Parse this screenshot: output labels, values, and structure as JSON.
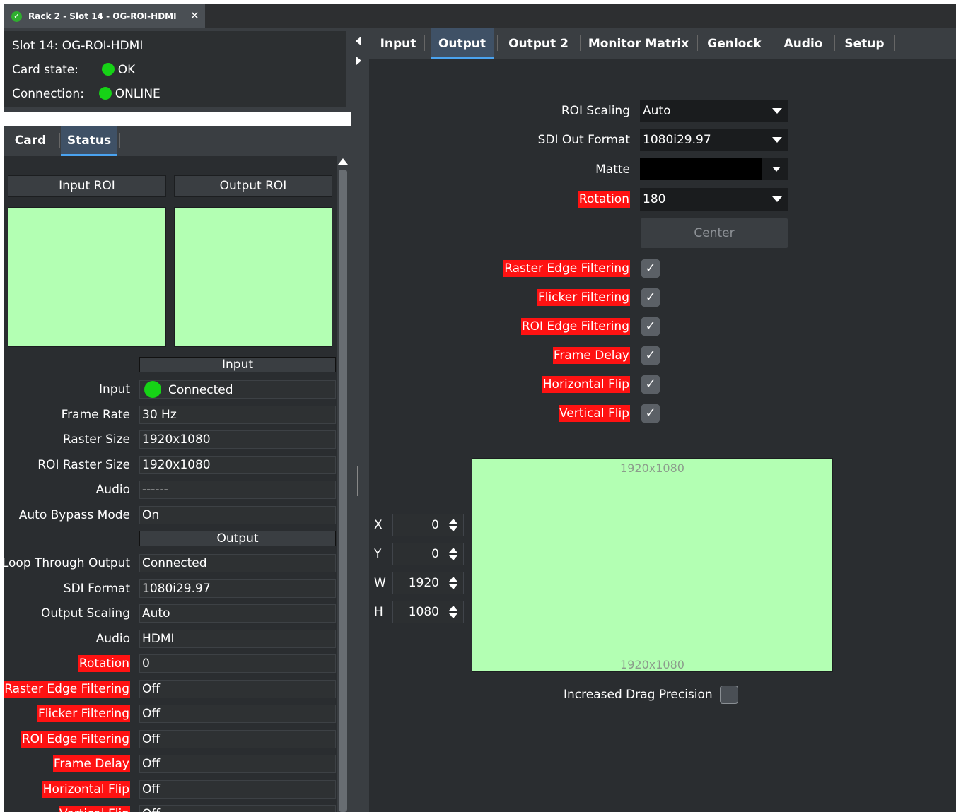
{
  "window": {
    "tab_title": "Rack 2 - Slot 14 - OG-ROI-HDMI",
    "close_glyph": "✕",
    "status_icon": "green-check-icon"
  },
  "card_info": {
    "slot": "Slot 14: OG-ROI-HDMI",
    "card_state_label": "Card state:",
    "card_state_value": "OK",
    "connection_label": "Connection:",
    "connection_value": "ONLINE",
    "status_color": "#16d216"
  },
  "left_tabs": [
    "Card",
    "Status"
  ],
  "left_active_tab": "Status",
  "status": {
    "roi_headers": [
      "Input ROI",
      "Output ROI"
    ],
    "input_section": "Input",
    "input_rows": [
      {
        "label": "Input",
        "value": "Connected",
        "red": false
      },
      {
        "label": "Frame Rate",
        "value": "30 Hz",
        "red": false
      },
      {
        "label": "Raster Size",
        "value": "1920x1080",
        "red": false
      },
      {
        "label": "ROI Raster Size",
        "value": "1920x1080",
        "red": false
      },
      {
        "label": "Audio",
        "value": "------",
        "red": false
      },
      {
        "label": "Auto Bypass Mode",
        "value": "On",
        "red": false
      }
    ],
    "output_section": "Output",
    "output_rows": [
      {
        "label": "Loop Through Output",
        "value": "Connected",
        "red": false
      },
      {
        "label": "SDI Format",
        "value": "1080i29.97",
        "red": false
      },
      {
        "label": "Output Scaling",
        "value": "Auto",
        "red": false
      },
      {
        "label": "Audio",
        "value": "HDMI",
        "red": false
      },
      {
        "label": "Rotation",
        "value": "0",
        "red": true
      },
      {
        "label": "Raster Edge Filtering",
        "value": "Off",
        "red": true
      },
      {
        "label": "Flicker Filtering",
        "value": "Off",
        "red": true
      },
      {
        "label": "ROI Edge Filtering",
        "value": "Off",
        "red": true
      },
      {
        "label": "Frame Delay",
        "value": "Off",
        "red": true
      },
      {
        "label": "Horizontal Flip",
        "value": "Off",
        "red": true
      },
      {
        "label": "Vertical Flip",
        "value": "Off",
        "red": true
      }
    ]
  },
  "top_tabs": [
    "Input",
    "Output",
    "Output 2",
    "Monitor Matrix",
    "Genlock",
    "Audio",
    "Setup"
  ],
  "top_active_tab": "Output",
  "output": {
    "roi_scaling_label": "ROI Scaling",
    "roi_scaling_value": "Auto",
    "sdi_out_format_label": "SDI Out Format",
    "sdi_out_format_value": "1080i29.97",
    "matte_label": "Matte",
    "matte_color": "#000000",
    "rotation_label": "Rotation",
    "rotation_value": "180",
    "center_button": "Center",
    "checks": [
      {
        "label": "Raster Edge Filtering",
        "checked": true
      },
      {
        "label": "Flicker Filtering",
        "checked": true
      },
      {
        "label": "ROI Edge Filtering",
        "checked": true
      },
      {
        "label": "Frame Delay",
        "checked": true
      },
      {
        "label": "Horizontal Flip",
        "checked": true
      },
      {
        "label": "Vertical Flip",
        "checked": true
      }
    ],
    "geometry": [
      {
        "label": "X",
        "value": "0"
      },
      {
        "label": "Y",
        "value": "0"
      },
      {
        "label": "W",
        "value": "1920"
      },
      {
        "label": "H",
        "value": "1080"
      }
    ],
    "preview_top_label": "1920x1080",
    "preview_bottom_label": "1920x1080",
    "drag_precision_label": "Increased Drag Precision",
    "drag_precision_checked": false,
    "check_glyph": "✓"
  },
  "colors": {
    "highlight_red": "#ff1212",
    "roi_green": "#b3ffb3",
    "active_tab_underline": "#4aa3f0"
  }
}
